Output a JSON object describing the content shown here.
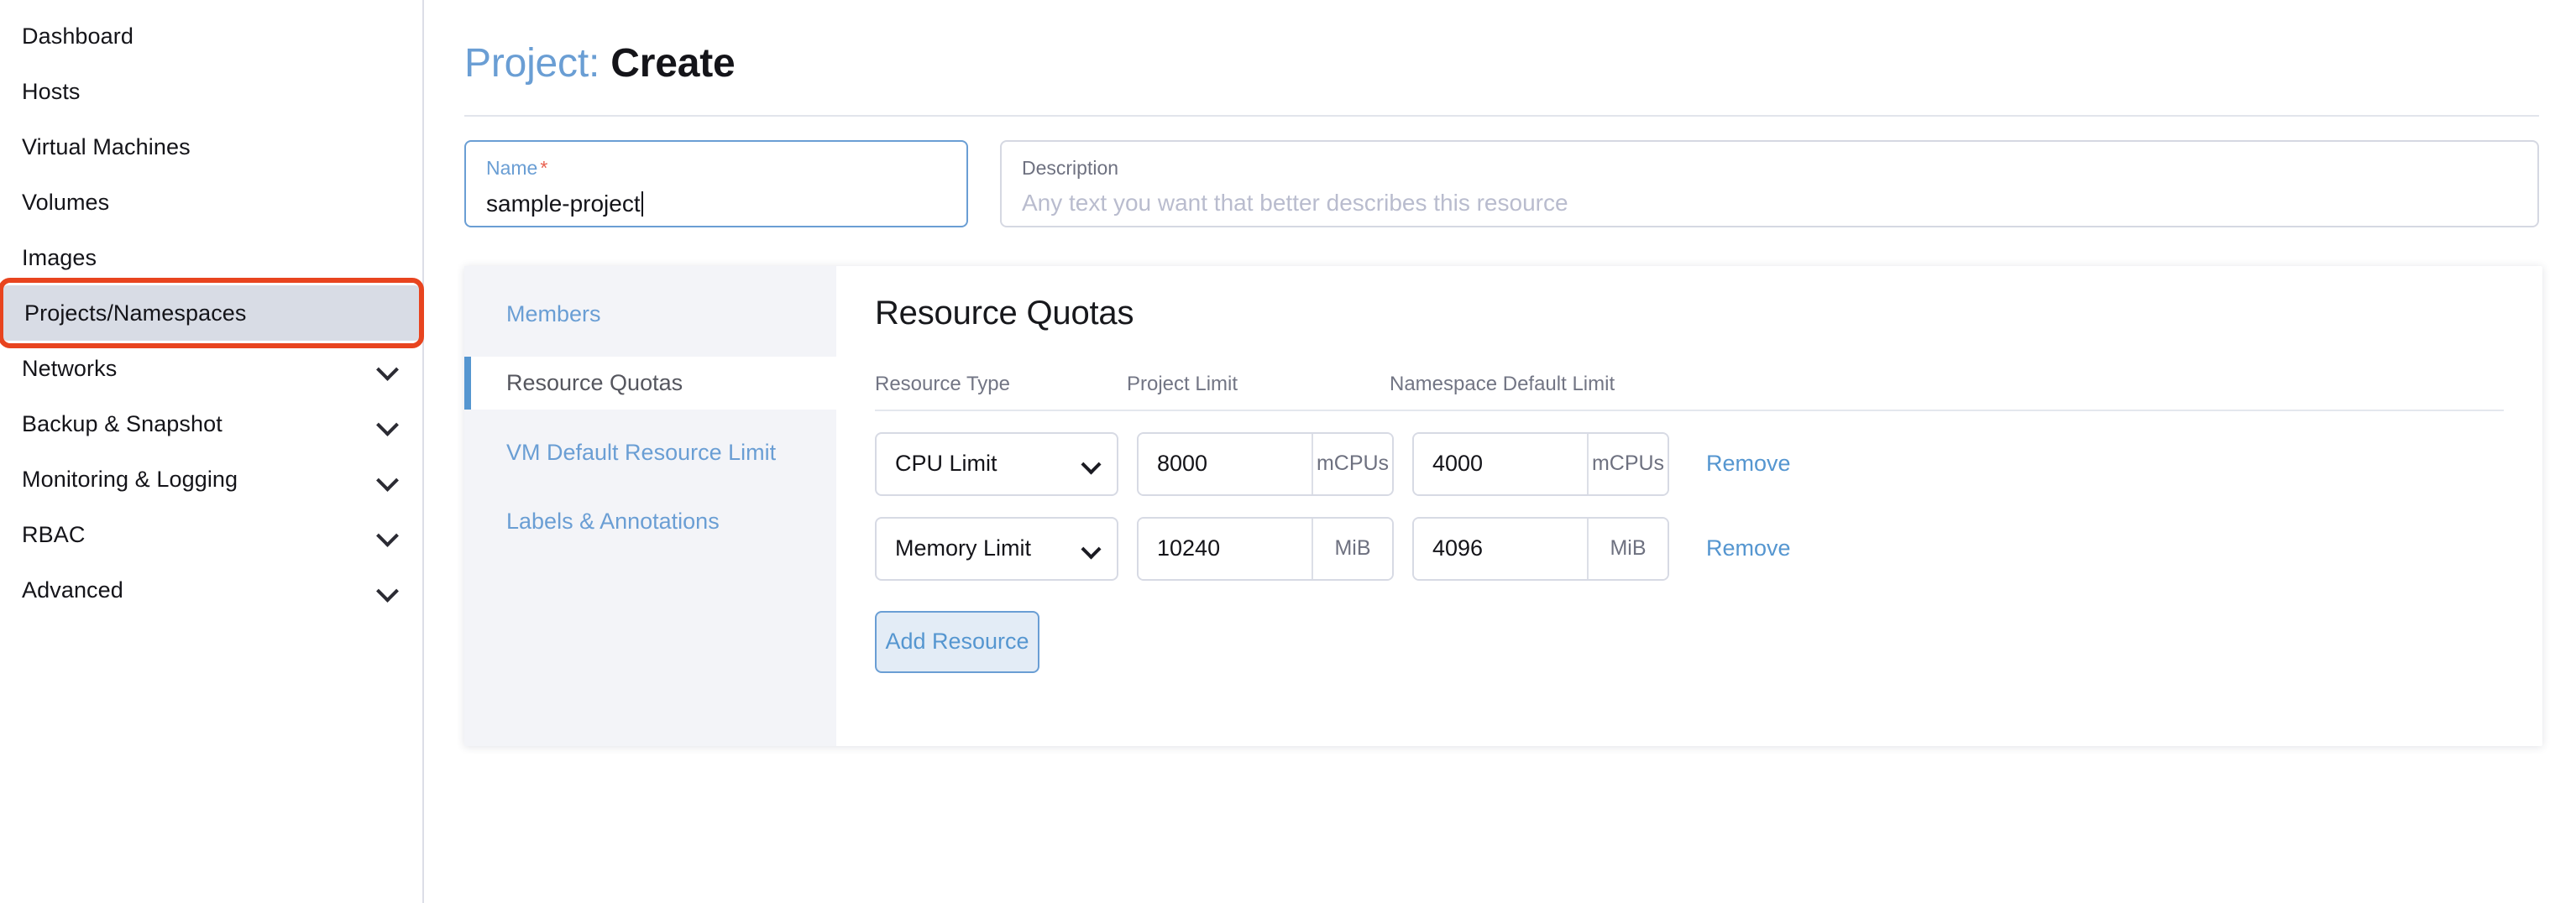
{
  "sidebar": {
    "items": [
      {
        "label": "Dashboard",
        "expandable": false,
        "selected": false,
        "annotated": false
      },
      {
        "label": "Hosts",
        "expandable": false,
        "selected": false,
        "annotated": false
      },
      {
        "label": "Virtual Machines",
        "expandable": false,
        "selected": false,
        "annotated": false
      },
      {
        "label": "Volumes",
        "expandable": false,
        "selected": false,
        "annotated": false
      },
      {
        "label": "Images",
        "expandable": false,
        "selected": false,
        "annotated": false
      },
      {
        "label": "Projects/Namespaces",
        "expandable": false,
        "selected": true,
        "annotated": true
      },
      {
        "label": "Networks",
        "expandable": true,
        "selected": false,
        "annotated": false
      },
      {
        "label": "Backup & Snapshot",
        "expandable": true,
        "selected": false,
        "annotated": false
      },
      {
        "label": "Monitoring & Logging",
        "expandable": true,
        "selected": false,
        "annotated": false
      },
      {
        "label": "RBAC",
        "expandable": true,
        "selected": false,
        "annotated": false
      },
      {
        "label": "Advanced",
        "expandable": true,
        "selected": false,
        "annotated": false
      }
    ]
  },
  "header": {
    "title_prefix": "Project:",
    "title_suffix": "Create"
  },
  "form": {
    "name": {
      "label": "Name",
      "required_marker": "*",
      "value": "sample-project"
    },
    "description": {
      "label": "Description",
      "placeholder": "Any text you want that better describes this resource",
      "value": ""
    }
  },
  "tabs": [
    {
      "label": "Members",
      "active": false
    },
    {
      "label": "Resource Quotas",
      "active": true
    },
    {
      "label": "VM Default Resource Limit",
      "active": false
    },
    {
      "label": "Labels & Annotations",
      "active": false
    }
  ],
  "panel": {
    "title": "Resource Quotas",
    "columns": {
      "resource_type": "Resource Type",
      "project_limit": "Project Limit",
      "namespace_default_limit": "Namespace Default Limit"
    },
    "rows": [
      {
        "resource_type": "CPU Limit",
        "project_limit": "8000",
        "project_unit": "mCPUs",
        "namespace_limit": "4000",
        "namespace_unit": "mCPUs",
        "remove_label": "Remove"
      },
      {
        "resource_type": "Memory Limit",
        "project_limit": "10240",
        "project_unit": "MiB",
        "namespace_limit": "4096",
        "namespace_unit": "MiB",
        "remove_label": "Remove"
      }
    ],
    "add_button": "Add Resource"
  },
  "colors": {
    "accent_blue": "#5596d0",
    "link_blue": "#6a9ed4",
    "annotation_red": "#e8441f",
    "required_red": "#e8604f",
    "tab_panel_bg": "#f3f4f8",
    "selected_nav_bg": "#d8dce5"
  }
}
